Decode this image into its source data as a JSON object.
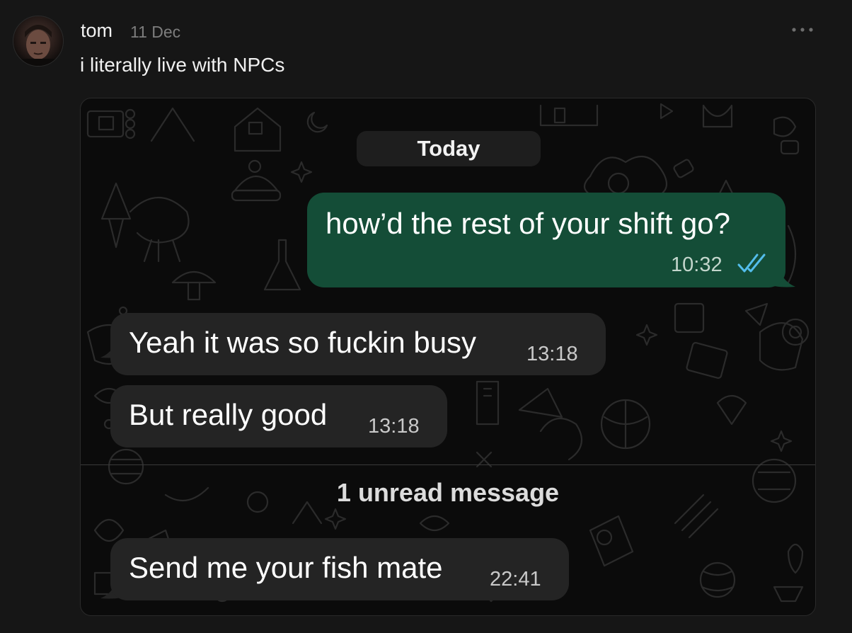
{
  "post": {
    "author": "tom",
    "date": "11 Dec",
    "text": "i literally live with NPCs"
  },
  "chat": {
    "day_label": "Today",
    "messages": [
      {
        "direction": "outgoing",
        "text": "how’d the rest of your shift go?",
        "time": "10:32",
        "status": "read"
      },
      {
        "direction": "incoming",
        "text": "Yeah it was so fuckin busy",
        "time": "13:18"
      },
      {
        "direction": "incoming",
        "text": "But really good",
        "time": "13:18"
      },
      {
        "direction": "incoming",
        "text": "Send me your fish mate",
        "time": "22:41"
      }
    ],
    "unread_label": "1 unread message"
  },
  "icons": {
    "more": "more-options-icon",
    "read_receipt": "double-check-icon",
    "avatar": "user-avatar"
  },
  "colors": {
    "outgoing_bubble": "#144d37",
    "incoming_bubble": "#242424",
    "read_tick": "#53bdeb"
  }
}
